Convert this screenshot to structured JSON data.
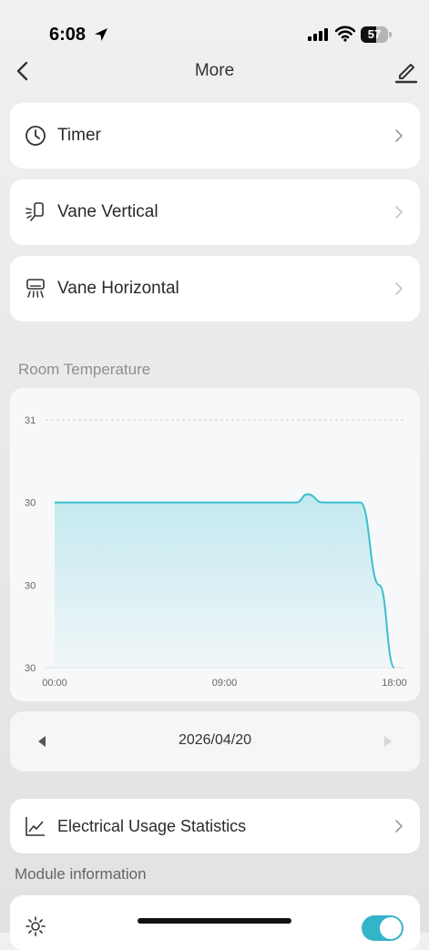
{
  "status_bar": {
    "time": "6:08",
    "battery": "57",
    "battery_level": 0.57
  },
  "nav": {
    "title": "More",
    "back_icon": "chevron-left-icon",
    "edit_icon": "pen-icon"
  },
  "menu": [
    {
      "label": "Timer",
      "icon": "clock-icon"
    },
    {
      "label": "Vane Vertical",
      "icon": "vane-vertical-icon"
    },
    {
      "label": "Vane Horizontal",
      "icon": "vane-horizontal-icon"
    }
  ],
  "room_temp": {
    "section_title": "Room Temperature"
  },
  "chart_data": {
    "type": "area",
    "title": "",
    "xlabel": "",
    "ylabel": "",
    "x_tick_labels": [
      "00:00",
      "09:00",
      "18:00"
    ],
    "y_tick_labels": [
      "31",
      "30",
      "30",
      "30"
    ],
    "x_hours": [
      0,
      6,
      10,
      11,
      11.6,
      12.4,
      12.8,
      13.4,
      14.2,
      15.0,
      15.6,
      16.2,
      17.2,
      18.0
    ],
    "values": [
      30.5,
      30.5,
      30.5,
      30.5,
      30.5,
      30.5,
      30.5,
      30.55,
      30.5,
      30.5,
      30.5,
      30.5,
      30.0,
      29.5
    ],
    "xlim": [
      0,
      18
    ],
    "ylim": [
      29.5,
      31
    ],
    "grid": "dashed horizontal at top tick",
    "line_color": "#3bbfd0",
    "fill_color": "#bfe8ef"
  },
  "date_nav": {
    "date": "2026/04/20",
    "prev_icon": "triangle-left-icon",
    "next_icon": "triangle-right-icon"
  },
  "electrical": {
    "label": "Electrical Usage Statistics",
    "icon": "line-chart-icon"
  },
  "module_info": {
    "section_title": "Module information"
  },
  "bottom_row": {
    "icon": "sun-icon",
    "toggle_on": true
  },
  "colors": {
    "accent": "#34b4c8"
  }
}
